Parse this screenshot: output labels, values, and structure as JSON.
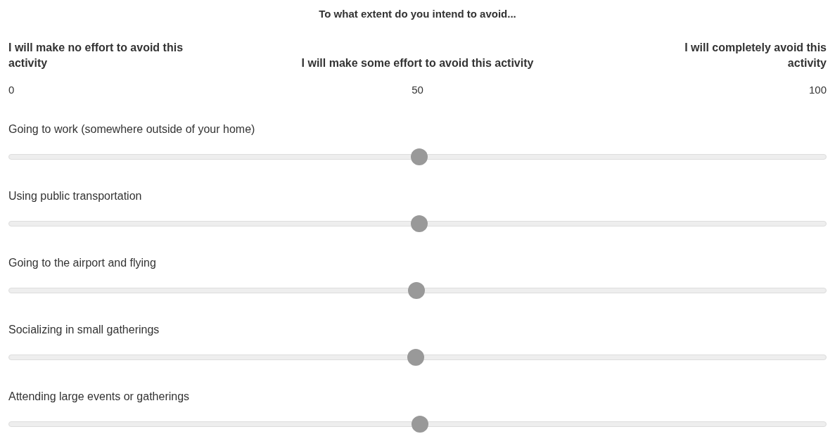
{
  "question": "To what extent do you intend to avoid...",
  "anchors": [
    "I will make no effort to avoid this activity",
    "I will make some effort to avoid this activity",
    "I will completely avoid this activity"
  ],
  "scale": [
    "0",
    "50",
    "100"
  ],
  "items": [
    {
      "label": "Going to work (somewhere outside of your home)",
      "level": 0.502
    },
    {
      "label": "Using public transportation",
      "level": 0.502
    },
    {
      "label": "Going to the airport and flying",
      "level": 0.499
    },
    {
      "label": "Socializing in small gatherings",
      "level": 0.498
    },
    {
      "label": "Attending large events or gatherings",
      "level": 0.503
    }
  ]
}
